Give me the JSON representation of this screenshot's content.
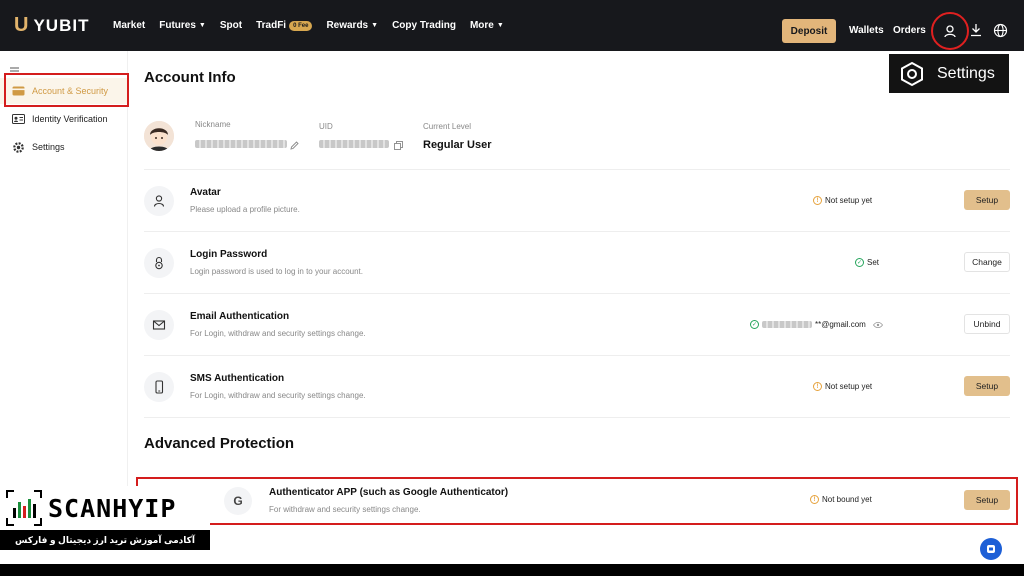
{
  "brand": {
    "name": "YUBIT",
    "mark": "U"
  },
  "nav": {
    "items": [
      {
        "label": "Market",
        "caret": false
      },
      {
        "label": "Futures",
        "caret": true
      },
      {
        "label": "Spot",
        "caret": false
      },
      {
        "label": "TradFi",
        "caret": false,
        "badge": "0 Fee"
      },
      {
        "label": "Rewards",
        "caret": true
      },
      {
        "label": "Copy Trading",
        "caret": false
      },
      {
        "label": "More",
        "caret": true
      }
    ],
    "deposit": "Deposit",
    "wallets": "Wallets",
    "orders": "Orders"
  },
  "settings_tag": {
    "label": "Settings"
  },
  "sidebar": {
    "items": [
      {
        "label": "Account & Security",
        "icon": "card-icon"
      },
      {
        "label": "Identity Verification",
        "icon": "id-card-icon"
      },
      {
        "label": "Settings",
        "icon": "gear-icon"
      }
    ]
  },
  "account": {
    "title": "Account Info",
    "nickname_label": "Nickname",
    "uid_label": "UID",
    "level_label": "Current Level",
    "level_value": "Regular User"
  },
  "rows": [
    {
      "title": "Avatar",
      "desc": "Please upload a profile picture.",
      "status": "Not setup yet",
      "action": "Setup"
    },
    {
      "title": "Login Password",
      "desc": "Login password is used to log in to your account.",
      "status": "Set",
      "action": "Change"
    },
    {
      "title": "Email Authentication",
      "desc": "For Login, withdraw and security settings change.",
      "status": "**@gmail.com",
      "action": "Unbind"
    },
    {
      "title": "SMS Authentication",
      "desc": "For Login, withdraw and security settings change.",
      "status": "Not setup yet",
      "action": "Setup"
    }
  ],
  "advanced": {
    "title": "Advanced Protection",
    "auth_title": "Authenticator APP (such as Google Authenticator)",
    "auth_desc": "For withdraw and security settings change.",
    "auth_status": "Not bound yet",
    "auth_action": "Setup",
    "auth_icon_letter": "G"
  },
  "watermark": {
    "brand": "SCANHYIP",
    "subtitle": "آکادمی آموزش ترید ارز دیجیتال و فارکس"
  },
  "colors": {
    "topbar": "#17181c",
    "accent_gold": "#e2b57a",
    "highlight_red": "#d41d1d",
    "success": "#25a55c",
    "warning": "#e6a23c"
  }
}
